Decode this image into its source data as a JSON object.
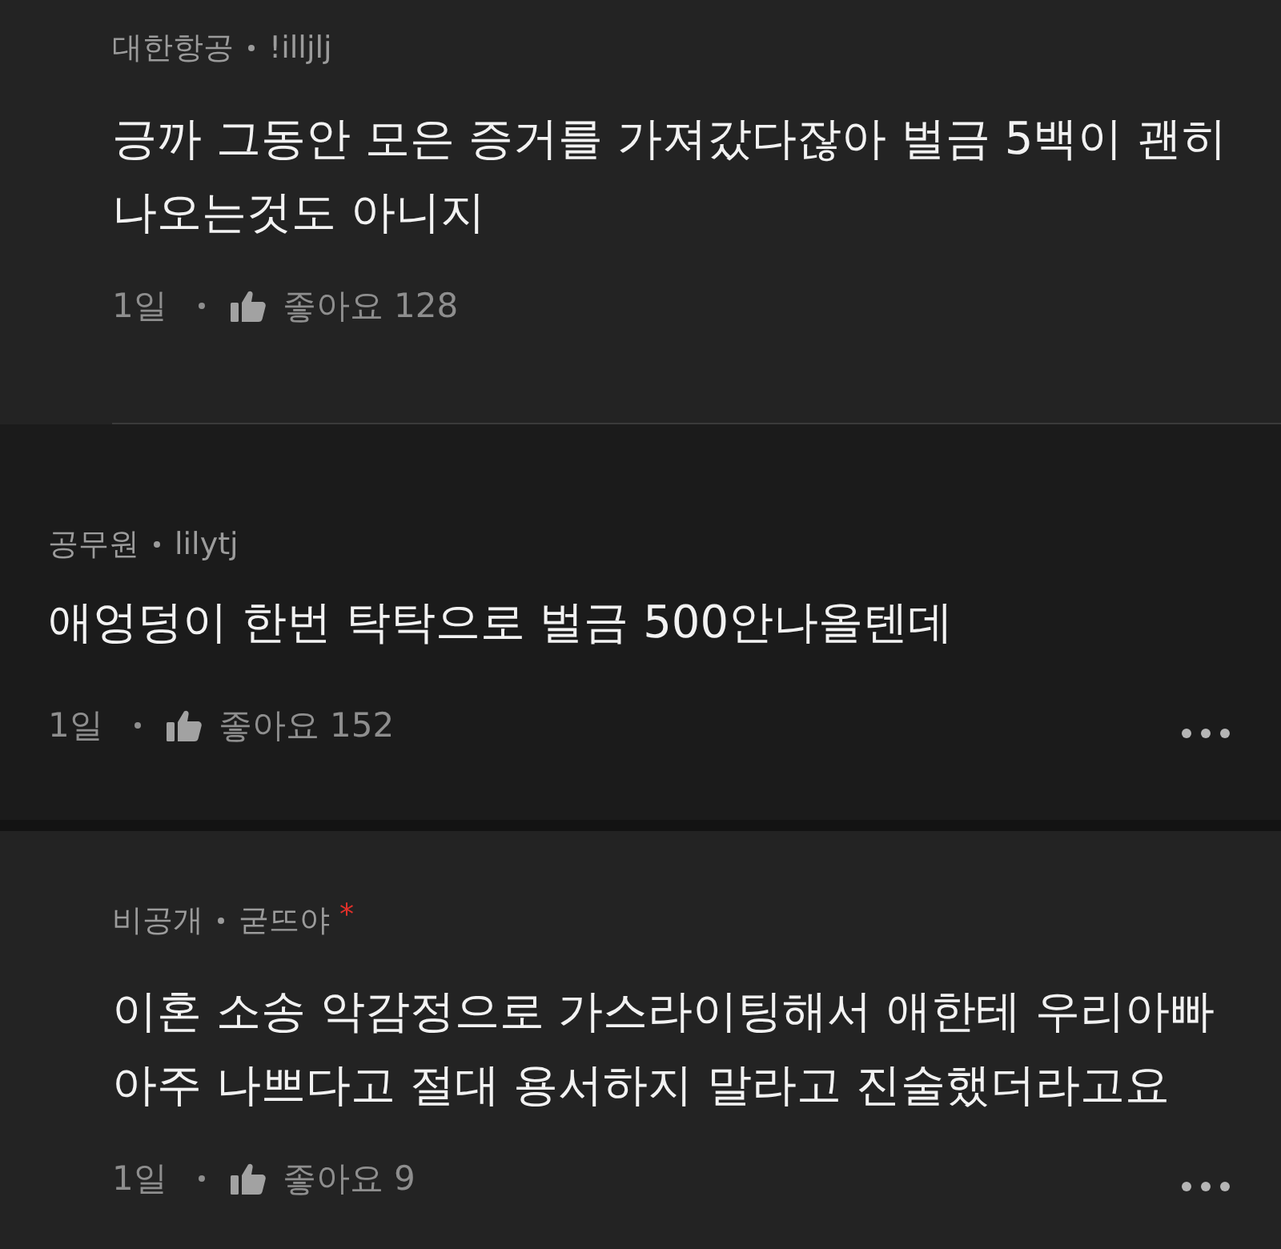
{
  "comments": [
    {
      "kind": "reply",
      "company": "대한항공",
      "nickname": "!illjlj",
      "body": "긍까 그동안 모은 증거를 가져갔다잖아 벌금 5백이 괜히 나오는것도 아니지",
      "time": "1일",
      "likes": "좋아요 128",
      "more_menu": false
    },
    {
      "kind": "comment",
      "company": "공무원",
      "nickname": "lilytj",
      "body": "애엉덩이 한번 탁탁으로 벌금 500안나올텐데",
      "time": "1일",
      "likes": "좋아요 152",
      "more_menu": true
    },
    {
      "kind": "reply",
      "company": "비공개",
      "nickname": "굳뜨야",
      "author_mark": "*",
      "body": "이혼 소송 악감정으로 가스라이팅해서 애한테 우리아빠 아주 나쁘다고 절대 용서하지 말라고 진술했더라고요",
      "time": "1일",
      "likes": "좋아요 9",
      "more_menu": true
    }
  ]
}
